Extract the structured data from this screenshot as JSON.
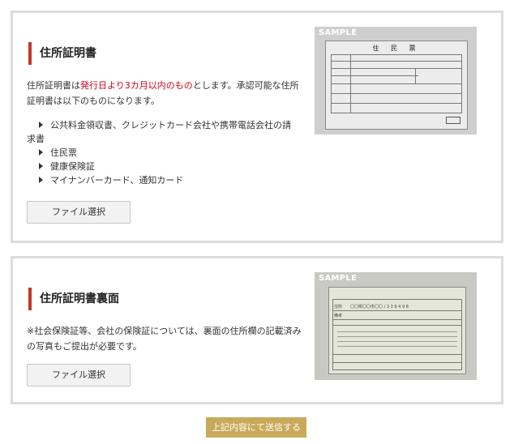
{
  "section_address": {
    "title": "住所証明書",
    "desc_prefix": "住所証明書は",
    "desc_highlight": "発行日より3カ月以内のもの",
    "desc_suffix": "とします。承認可能な住所証明書は以下のものになります。",
    "items": [
      "公共料金領収書、クレジットカード会社や携帯電話会社の請求書",
      "住民票",
      "健康保険証",
      "マイナンバーカード、通知カード"
    ],
    "file_button": "ファイル選択",
    "sample_label": "SAMPLE",
    "sample_doc_title": "住 民 票"
  },
  "section_back": {
    "title": "住所証明書裏面",
    "desc": "※社会保険証等、会社の保険証については、裏面の住所欄の記載済みの写真もご提出が必要です。",
    "file_button": "ファイル選択",
    "sample_label": "SAMPLE",
    "sample_field_address": "住所",
    "sample_field_note": "備考",
    "sample_address_value": "〇〇県〇〇市〇〇 / 3 3 9 4 9 8"
  },
  "submit_button": "上記内容にて送信する",
  "colors": {
    "accent_bar": "#c0392b",
    "highlight_text": "#d0021b",
    "submit_bg": "#c9a95a",
    "card_border": "#dcdcdc"
  }
}
